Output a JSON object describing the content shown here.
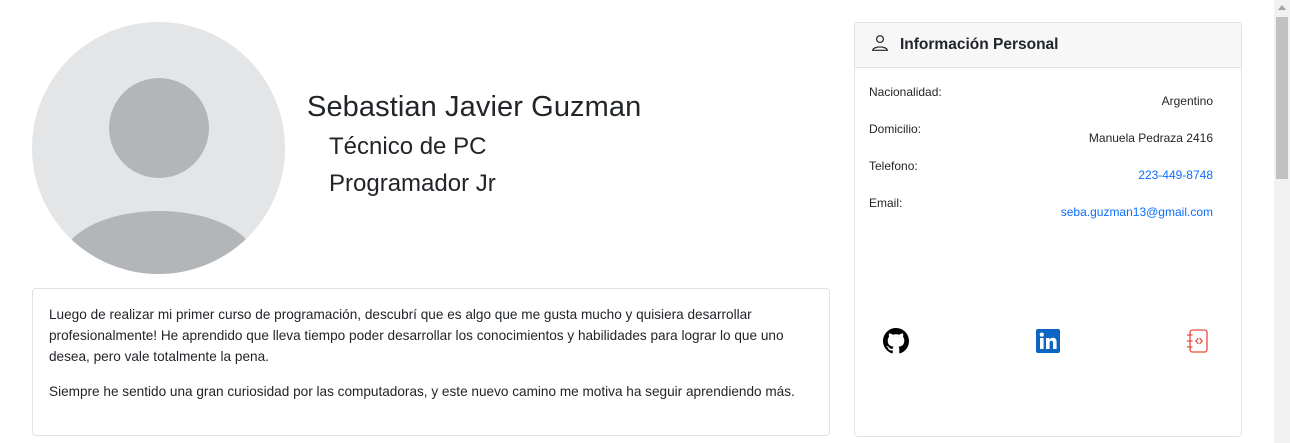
{
  "profile": {
    "name": "Sebastian Javier Guzman",
    "roles": [
      "Técnico de PC",
      "Programador Jr"
    ]
  },
  "about": {
    "paragraphs": [
      "Luego de realizar mi primer curso de programación, descubrí que es algo que me gusta mucho y quisiera desarrollar profesionalmente! He aprendido que lleva tiempo poder desarrollar los conocimientos y habilidades para lograr lo que uno desea, pero vale totalmente la pena.",
      "Siempre he sentido una gran curiosidad por las computadoras, y este nuevo camino me motiva ha seguir aprendiendo más."
    ]
  },
  "personal_info": {
    "title": "Información Personal",
    "icon": "person-icon",
    "rows": [
      {
        "label": "Nacionalidad:",
        "value": "Argentino"
      },
      {
        "label": "Domicilio:",
        "value": "Manuela Pedraza 2416"
      },
      {
        "label": "Telefono:",
        "value": "223-449-8748"
      },
      {
        "label": "Email:",
        "value": "seba.guzman13@gmail.com"
      }
    ]
  },
  "social": [
    {
      "name": "github-icon"
    },
    {
      "name": "linkedin-icon"
    },
    {
      "name": "code-file-icon"
    }
  ],
  "colors": {
    "link": "#0d6efd",
    "linkedin": "#0a66c2",
    "code_icon": "#e74c3c",
    "avatar_bg": "#e4e5e7",
    "avatar_fg": "#b3b6b9"
  }
}
